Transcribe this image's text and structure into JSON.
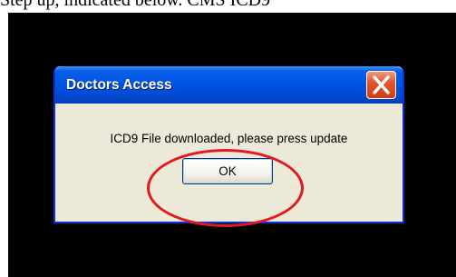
{
  "caption": {
    "text": "Step up, indicated below. CMS ICD9"
  },
  "dialog": {
    "title": "Doctors Access",
    "message": "ICD9 File downloaded, please press update",
    "ok_label": "OK",
    "close_icon": "close-icon"
  },
  "colors": {
    "titlebar": "#0054e3",
    "dialog_bg": "#ece9d8",
    "close_button": "#d23c12",
    "annotation": "#e3191f",
    "screen_bg": "#000000"
  }
}
